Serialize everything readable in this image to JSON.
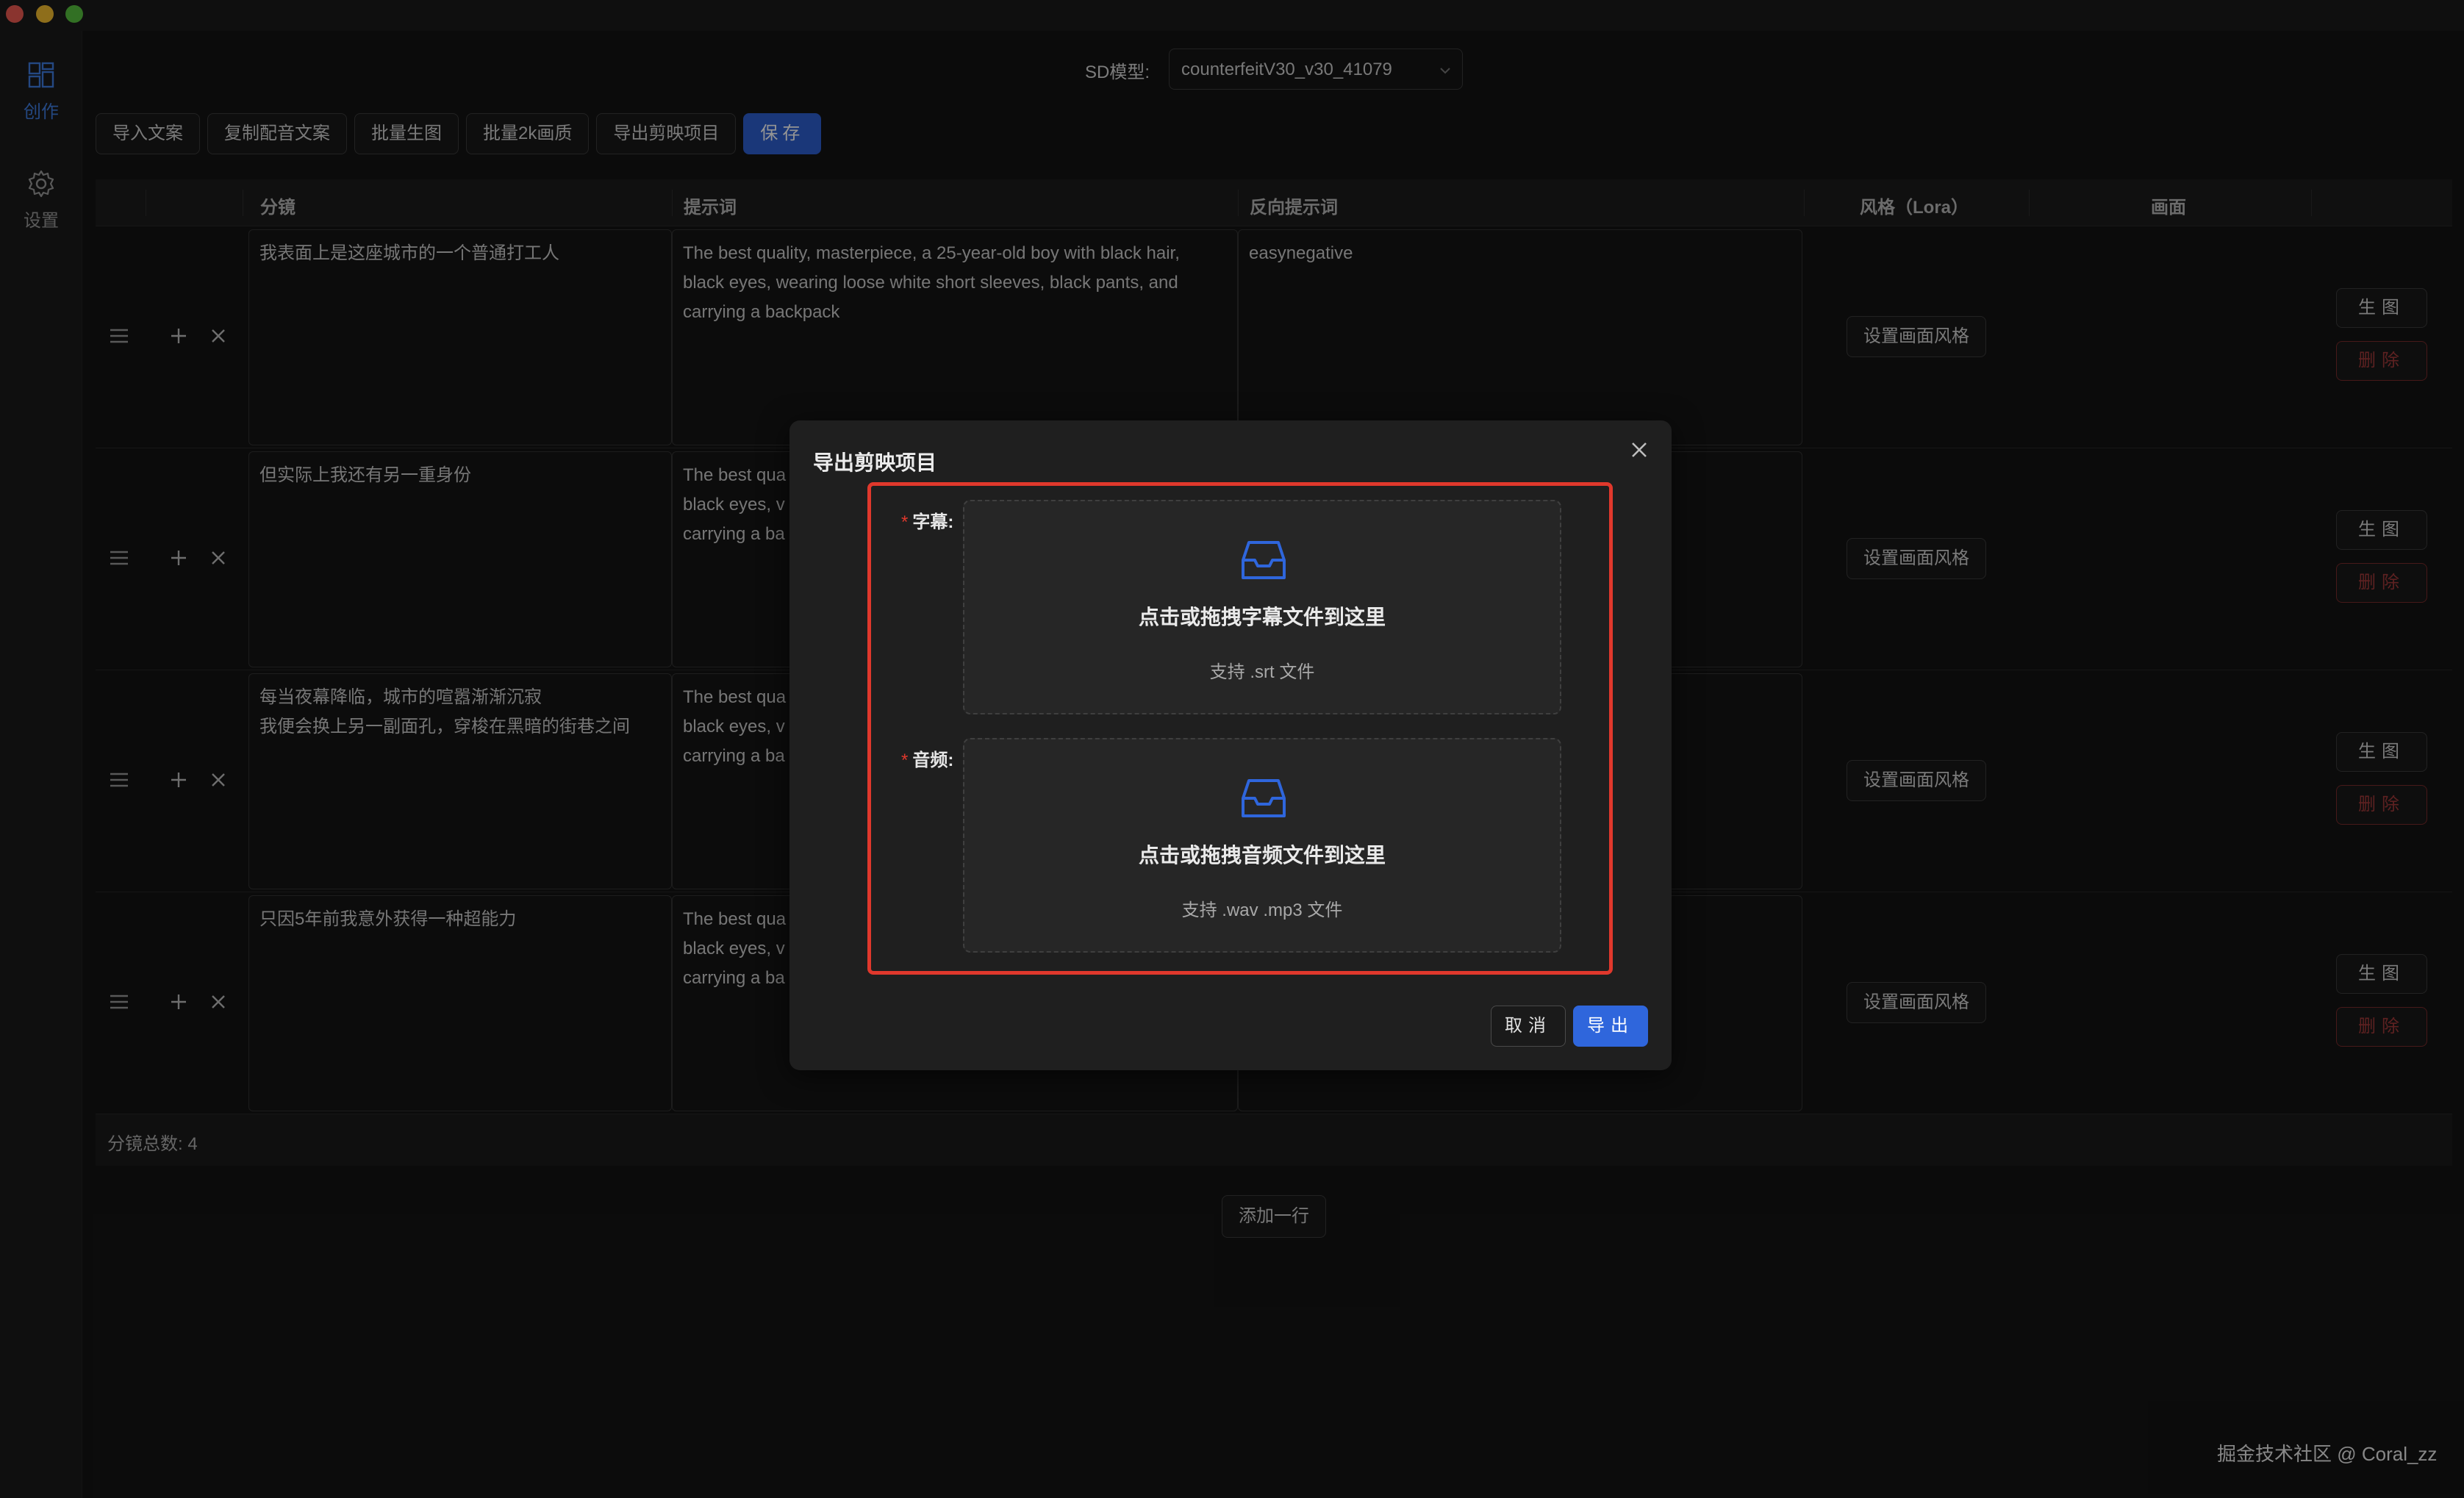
{
  "sidebar": {
    "items": [
      {
        "label": "创作",
        "icon": "grid-icon",
        "active": true
      },
      {
        "label": "设置",
        "icon": "gear-icon",
        "active": false
      }
    ]
  },
  "topbar": {
    "sd_label": "SD模型:",
    "sd_model_value": "counterfeitV30_v30_41079"
  },
  "toolbar": {
    "import_text": "导入文案",
    "copy_dub_text": "复制配音文案",
    "batch_generate": "批量生图",
    "batch_2k": "批量2k画质",
    "export_jianying": "导出剪映项目",
    "save": "保存"
  },
  "table": {
    "headers": {
      "storyboard": "分镜",
      "prompt": "提示词",
      "negative_prompt": "反向提示词",
      "style": "风格（Lora）",
      "image": "画面"
    },
    "rows": [
      {
        "storyboard": "我表面上是这座城市的一个普通打工人",
        "prompt": "The best quality, masterpiece, a 25-year-old boy with black hair,\nblack eyes, wearing loose white short sleeves, black pants, and\ncarrying a backpack",
        "negative_prompt": "easynegative",
        "style_button": "设置画面风格",
        "generate_button": "生图",
        "delete_button": "删除"
      },
      {
        "storyboard": "但实际上我还有另一重身份",
        "prompt": "The best qua\nblack eyes, v\ncarrying a ba",
        "negative_prompt": "",
        "style_button": "设置画面风格",
        "generate_button": "生图",
        "delete_button": "删除"
      },
      {
        "storyboard": "每当夜幕降临，城市的喧嚣渐渐沉寂\n我便会换上另一副面孔，穿梭在黑暗的街巷之间",
        "prompt": "The best qua\nblack eyes, v\ncarrying a ba",
        "negative_prompt": "",
        "style_button": "设置画面风格",
        "generate_button": "生图",
        "delete_button": "删除"
      },
      {
        "storyboard": "只因5年前我意外获得一种超能力",
        "prompt": "The best qua\nblack eyes, v\ncarrying a ba",
        "negative_prompt": "",
        "style_button": "设置画面风格",
        "generate_button": "生图",
        "delete_button": "删除"
      }
    ],
    "footer_total": "分镜总数:  4"
  },
  "add_row": "添加一行",
  "watermark": "掘金技术社区 @ Coral_zz",
  "modal": {
    "title": "导出剪映项目",
    "subtitle_field": {
      "label": "字幕:",
      "required_mark": "*",
      "drop_text": "点击或拖拽字幕文件到这里",
      "hint": "支持 .srt 文件"
    },
    "audio_field": {
      "label": "音频:",
      "required_mark": "*",
      "drop_text": "点击或拖拽音频文件到这里",
      "hint": "支持 .wav .mp3 文件"
    },
    "cancel": "取消",
    "export": "导出"
  },
  "colors": {
    "accent": "#2f66dc",
    "danger": "#e0382c",
    "background": "#141414"
  }
}
